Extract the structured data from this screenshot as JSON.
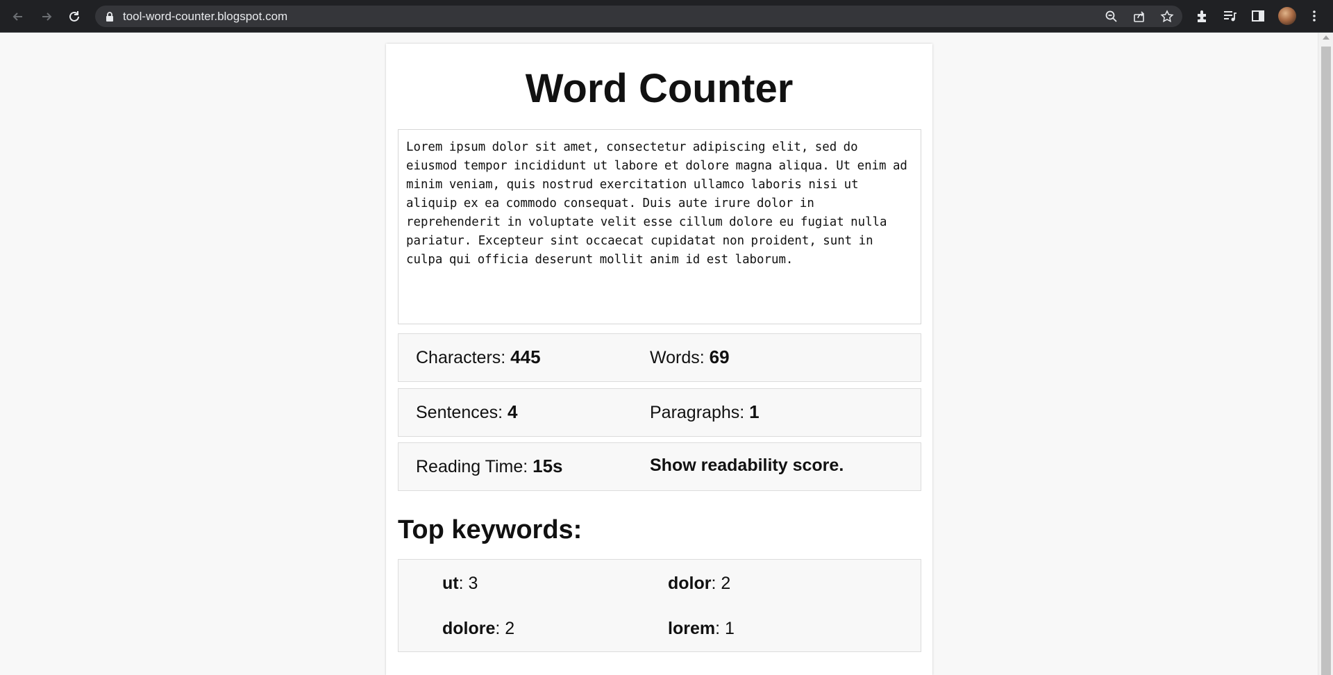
{
  "browser": {
    "url": "tool-word-counter.blogspot.com"
  },
  "page": {
    "title": "Word Counter",
    "input_text": "Lorem ipsum dolor sit amet, consectetur adipiscing elit, sed do eiusmod tempor incididunt ut labore et dolore magna aliqua. Ut enim ad minim veniam, quis nostrud exercitation ullamco laboris nisi ut aliquip ex ea commodo consequat. Duis aute irure dolor in reprehenderit in voluptate velit esse cillum dolore eu fugiat nulla pariatur. Excepteur sint occaecat cupidatat non proident, sunt in culpa qui officia deserunt mollit anim id est laborum.",
    "stats": {
      "characters_label": "Characters: ",
      "characters_value": "445",
      "words_label": "Words: ",
      "words_value": "69",
      "sentences_label": "Sentences: ",
      "sentences_value": "4",
      "paragraphs_label": "Paragraphs: ",
      "paragraphs_value": "1",
      "reading_time_label": "Reading Time: ",
      "reading_time_value": "15s",
      "readability_link": "Show readability score."
    },
    "keywords_heading": "Top keywords:",
    "keywords": [
      {
        "word": "ut",
        "count": ": 3"
      },
      {
        "word": "dolor",
        "count": ": 2"
      },
      {
        "word": "dolore",
        "count": ": 2"
      },
      {
        "word": "lorem",
        "count": ": 1"
      }
    ]
  },
  "icons": [
    "back-icon",
    "forward-icon",
    "reload-icon",
    "lock-icon",
    "zoom-icon",
    "share-icon",
    "star-icon",
    "extensions-icon",
    "media-icon",
    "side-panel-icon",
    "avatar",
    "menu-icon"
  ],
  "colors": {
    "chrome_bg": "#202124",
    "omnibox_bg": "#35363a",
    "page_bg": "#f8f8f8",
    "card_bg": "#ffffff"
  }
}
